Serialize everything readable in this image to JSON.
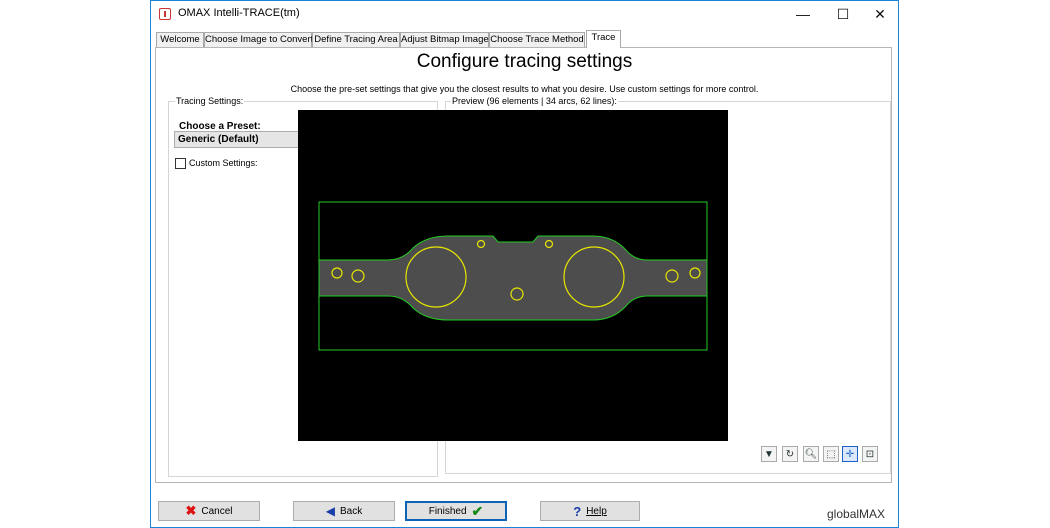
{
  "window": {
    "title": "OMAX Intelli-TRACE(tm)",
    "minimize": "—",
    "maximize": "☐",
    "close": "✕"
  },
  "tabs": [
    {
      "label": "Welcome"
    },
    {
      "label": "Choose Image to Convert"
    },
    {
      "label": "Define Tracing Area"
    },
    {
      "label": "Adjust Bitmap Image"
    },
    {
      "label": "Choose Trace Method"
    },
    {
      "label": "Trace",
      "active": true
    }
  ],
  "page": {
    "heading": "Configure tracing settings",
    "description": "Choose the pre-set settings that give you the closest results to what you desire.  Use custom settings for more control."
  },
  "tracing_settings": {
    "group_label": "Tracing Settings:",
    "preset_label": "Choose a Preset:",
    "preset_value": "Generic (Default)",
    "custom_settings_label": "Custom Settings:",
    "custom_settings_checked": false
  },
  "preview": {
    "group_label": "Preview (96 elements | 34 arcs, 62 lines):",
    "colors": {
      "outline": "#22cc22",
      "holes": "#e6e600",
      "fill": "#4d4d4d",
      "background": "#000000"
    }
  },
  "toolbar_icons": [
    "dropdown-arrow-icon",
    "refresh-icon",
    "zoom-icon",
    "zoom-window-icon",
    "pan-icon",
    "zoom-extents-icon"
  ],
  "buttons": {
    "cancel": "Cancel",
    "back": "Back",
    "finished": "Finished",
    "help": "Help"
  },
  "brand": "globalMAX"
}
